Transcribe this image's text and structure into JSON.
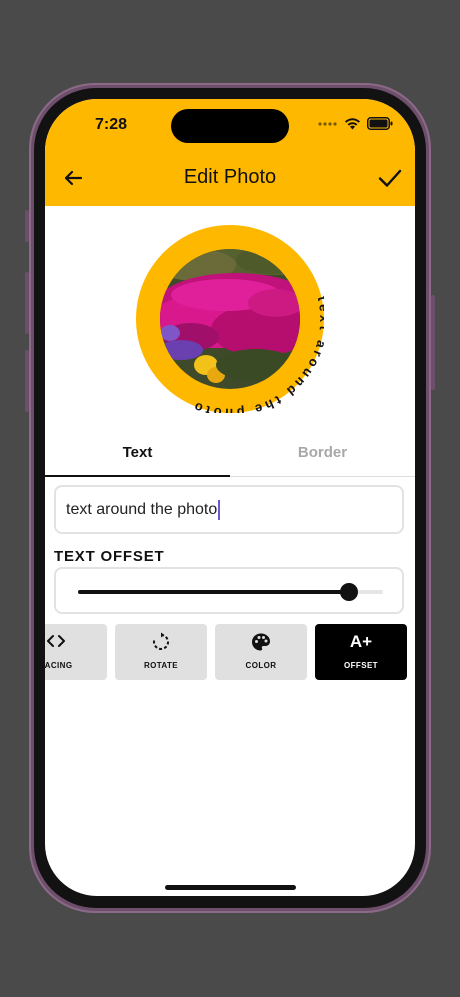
{
  "status_bar": {
    "time": "7:28"
  },
  "app_bar": {
    "title": "Edit Photo"
  },
  "preview": {
    "circular_text": "text around the photo",
    "ring_color": "#FFB800"
  },
  "tabs": [
    {
      "label": "Text",
      "active": true
    },
    {
      "label": "Border",
      "active": false
    }
  ],
  "text_input": {
    "value": "text around the photo"
  },
  "offset": {
    "label": "TEXT OFFSET",
    "value_fraction": 0.89
  },
  "tools": [
    {
      "label": "PACING",
      "icon": "code-brackets-icon",
      "active": false
    },
    {
      "label": "ROTATE",
      "icon": "rotate-icon",
      "active": false
    },
    {
      "label": "COLOR",
      "icon": "palette-icon",
      "active": false
    },
    {
      "label": "OFFSET",
      "icon": "A+",
      "active": true
    }
  ],
  "colors": {
    "accent": "#FFB800",
    "dark": "#111111",
    "tool_bg": "#E0E0E0"
  }
}
